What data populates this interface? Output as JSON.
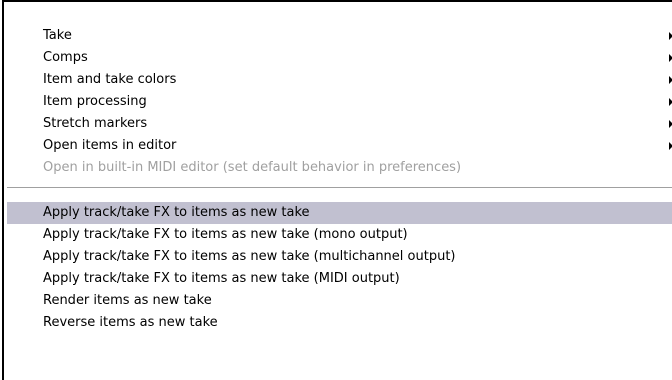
{
  "menu": {
    "submenu_items": [
      {
        "label": "Take"
      },
      {
        "label": "Comps"
      },
      {
        "label": "Item and take colors"
      },
      {
        "label": "Item processing"
      },
      {
        "label": "Stretch markers"
      },
      {
        "label": "Open items in editor"
      }
    ],
    "disabled_item": {
      "label": "Open in built-in MIDI editor (set default behavior in preferences)"
    },
    "action_items": [
      {
        "label": "Apply track/take FX to items as new take",
        "highlighted": true
      },
      {
        "label": "Apply track/take FX to items as new take (mono output)"
      },
      {
        "label": "Apply track/take FX to items as new take (multichannel output)"
      },
      {
        "label": "Apply track/take FX to items as new take (MIDI output)"
      },
      {
        "label": "Render items as new take"
      },
      {
        "label": "Reverse items as new take"
      }
    ],
    "colors": {
      "highlight": "#c1c0d0",
      "disabled_text": "#a0a0a0",
      "text": "#000000",
      "background": "#ffffff"
    }
  }
}
